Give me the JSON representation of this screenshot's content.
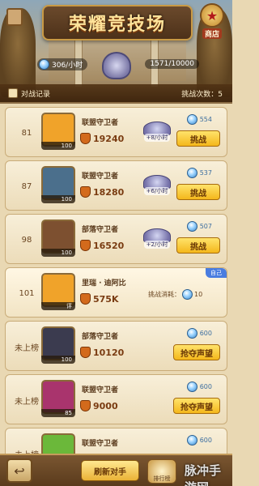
{
  "header": {
    "title": "荣耀竞技场",
    "shop_label": "商店",
    "energy": "306/小时",
    "score": "1571/10000",
    "records_label": "对战记录",
    "challenges_label": "挑战次数：5"
  },
  "colors": {
    "accent": "#f4b71b",
    "blue_tag": "#4a7de0",
    "power": "#7a3c12"
  },
  "rows": [
    {
      "rank": "81",
      "level": "100",
      "name": "联盟守卫者",
      "power": "19240",
      "reward": "+8/小时",
      "cost": "554",
      "action": "挑战",
      "avatar_color": "#f0a32a"
    },
    {
      "rank": "87",
      "level": "100",
      "name": "联盟守卫者",
      "power": "18280",
      "reward": "+6/小时",
      "cost": "537",
      "action": "挑战",
      "avatar_color": "#4b6f8c"
    },
    {
      "rank": "98",
      "level": "100",
      "name": "部落守卫者",
      "power": "16520",
      "reward": "+2/小时",
      "cost": "507",
      "action": "挑战",
      "avatar_color": "#7d5030"
    },
    {
      "rank": "101",
      "level": "评",
      "name": "里瑞 · 迪阿比",
      "power": "575K",
      "challenge_label": "挑战消耗：",
      "cost": "10",
      "tag": "自己",
      "avatar_color": "#f0a32a"
    },
    {
      "rank": "未上榜",
      "level": "100",
      "name": "部落守卫者",
      "power": "10120",
      "cost": "600",
      "action": "抢夺声望",
      "avatar_color": "#3b3b4f"
    },
    {
      "rank": "未上榜",
      "level": "85",
      "name": "联盟守卫者",
      "power": "9000",
      "cost": "600",
      "action": "抢夺声望",
      "avatar_color": "#a9346d"
    },
    {
      "rank": "未上榜",
      "level": "",
      "name": "联盟守卫者",
      "power": "",
      "cost": "600",
      "action": "",
      "avatar_color": "#6bb83a"
    }
  ],
  "footer": {
    "back_icon": "back-arrow-icon",
    "refresh_label": "刷新对手",
    "rank_label": "排行榜",
    "watermark": "脉冲手游网"
  }
}
